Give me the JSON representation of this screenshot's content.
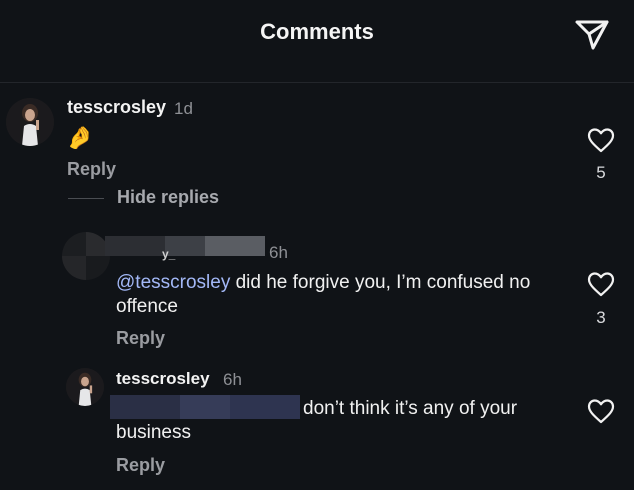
{
  "header": {
    "title": "Comments",
    "share_icon": "paper-plane-icon"
  },
  "comments": [
    {
      "username": "tesscrosley",
      "time": "1d",
      "emoji": "🤌",
      "reply_label": "Reply",
      "likes": "5",
      "hide_replies_label": "Hide replies",
      "replies": [
        {
          "username_visible": "y_",
          "time": "6h",
          "mention": "@tesscrosley",
          "text": " did he forgive you, I’m confused no offence",
          "reply_label": "Reply",
          "likes": "3"
        },
        {
          "username": "tesscrosley",
          "time": "6h",
          "text": "don’t think it’s any of your business",
          "reply_label": "Reply"
        }
      ]
    }
  ],
  "colors": {
    "background": "#101317",
    "mention": "#a3b8f7",
    "secondary_text": "#9a9ca1"
  }
}
